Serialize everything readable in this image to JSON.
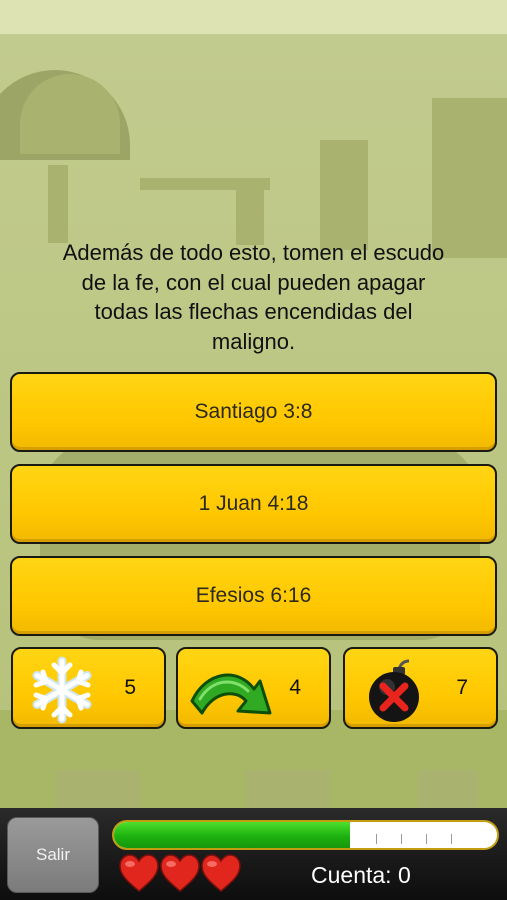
{
  "question": {
    "line1": "Además de todo esto, tomen el escudo",
    "line2": "de la fe, con el cual pueden apagar",
    "line3": "todas las flechas encendidas del",
    "line4": "maligno."
  },
  "answers": [
    {
      "label": "Santiago 3:8"
    },
    {
      "label": "1 Juan 4:18"
    },
    {
      "label": "Efesios 6:16"
    }
  ],
  "powerups": [
    {
      "icon": "snowflake-icon",
      "count": "5"
    },
    {
      "icon": "skip-arrow-icon",
      "count": "4"
    },
    {
      "icon": "bomb-icon",
      "count": "7"
    }
  ],
  "bottom_bar": {
    "exit_label": "Salir",
    "progress_fraction": 0.615,
    "lives": 3,
    "score_label": "Cuenta: 0"
  },
  "colors": {
    "answer_yellow": "#ffc800",
    "progress_green": "#1cb10f",
    "heart_red": "#e0261d"
  }
}
